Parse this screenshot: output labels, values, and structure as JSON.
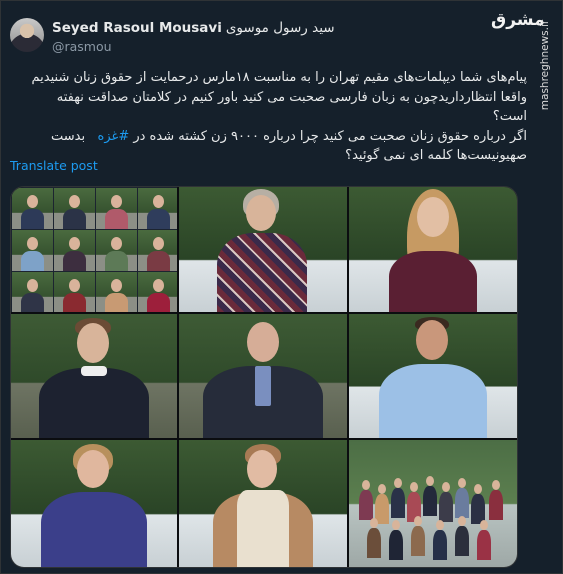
{
  "author": {
    "display_name_latin": "Seyed Rasoul Mousavi",
    "display_name_persian": "سید رسول موسوی",
    "handle": "@rasmou"
  },
  "watermark": {
    "logo": "مشرق",
    "url": "mashreghnews.ir"
  },
  "tweet": {
    "line1": "پیام‌های شما دیپلمات‌های مقیم تهران را به مناسبت ۱۸مارس درحمایت از حقوق زنان شنیدیم",
    "line2": "واقعا انتظارداریدچون به زبان فارسی صحبت می کنید باور کنیم در کلامتان صداقت نهفته است؟",
    "line3_before": "اگر درباره حقوق زنان صحبت می کنید چرا درباره ۹۰۰۰ زن کشته شده در",
    "hashtag": "#غزه",
    "line3_after": "بدست",
    "line4": "صهیونیست‌ها کلمه ای نمی گوئید؟"
  },
  "translate_label": "Translate post",
  "colors": {
    "background": "#15202b",
    "text": "#e7e9ea",
    "secondary_text": "#8b98a5",
    "link": "#1d9bf0"
  }
}
